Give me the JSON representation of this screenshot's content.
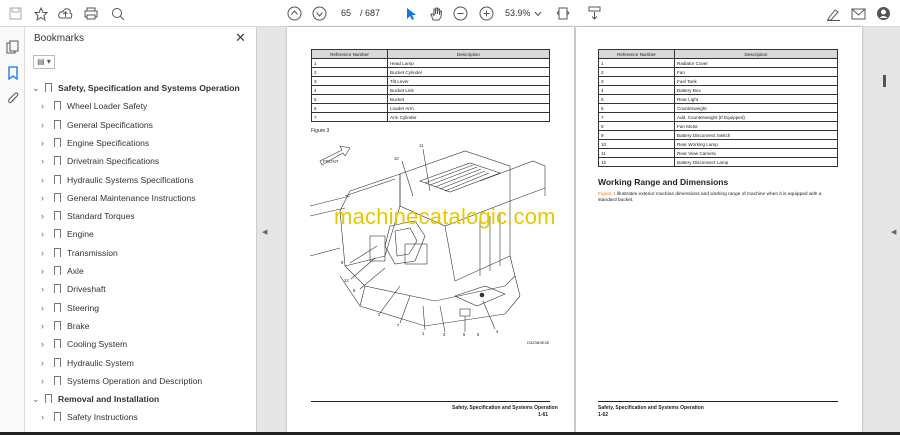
{
  "toolbar": {
    "page_current": "65",
    "page_total": "/ 687",
    "zoom": "53.9%"
  },
  "bookmarks_panel": {
    "title": "Bookmarks",
    "close": "✕",
    "items": [
      {
        "label": "Safety, Specification and Systems Operation",
        "level": 0,
        "expanded": true
      },
      {
        "label": "Wheel Loader Safety",
        "level": 1
      },
      {
        "label": "General Specifications",
        "level": 1
      },
      {
        "label": "Engine Specifications",
        "level": 1
      },
      {
        "label": "Drivetrain Specifications",
        "level": 1
      },
      {
        "label": "Hydraulic Systems Specifications",
        "level": 1
      },
      {
        "label": "General Maintenance Instructions",
        "level": 1
      },
      {
        "label": "Standard Torques",
        "level": 1
      },
      {
        "label": "Engine",
        "level": 1
      },
      {
        "label": "Transmission",
        "level": 1
      },
      {
        "label": "Axle",
        "level": 1
      },
      {
        "label": "Driveshaft",
        "level": 1
      },
      {
        "label": "Steering",
        "level": 1
      },
      {
        "label": "Brake",
        "level": 1
      },
      {
        "label": "Cooling System",
        "level": 1
      },
      {
        "label": "Hydraulic System",
        "level": 1
      },
      {
        "label": "Systems Operation and Description",
        "level": 1
      },
      {
        "label": "Removal and Installation",
        "level": 0,
        "expanded": true
      },
      {
        "label": "Safety Instructions",
        "level": 1
      }
    ]
  },
  "left_page": {
    "table_headers": [
      "Reference Number",
      "Description"
    ],
    "rows": [
      [
        "1",
        "Head Lamp"
      ],
      [
        "2",
        "Bucket Cylinder"
      ],
      [
        "3",
        "Tilt Lever"
      ],
      [
        "4",
        "Bucket Link"
      ],
      [
        "5",
        "Bucket"
      ],
      [
        "6",
        "Loader Arm"
      ],
      [
        "7",
        "Arm Cylinder"
      ]
    ],
    "figure_label": "Figure 3",
    "front_label": "FRONT",
    "callouts": [
      "10",
      "11",
      "9",
      "12",
      "8",
      "2",
      "7",
      "1",
      "3",
      "6",
      "5",
      "4"
    ],
    "drawing_code": "D3Z3B3E3E",
    "footer_title": "Safety, Specification and Systems Operation",
    "footer_page": "1-61"
  },
  "right_page": {
    "table_headers": [
      "Reference Number",
      "Description"
    ],
    "rows": [
      [
        "1",
        "Radiator Cover"
      ],
      [
        "2",
        "Fan"
      ],
      [
        "3",
        "Fuel Tank"
      ],
      [
        "4",
        "Battery Box"
      ],
      [
        "5",
        "Rear Light"
      ],
      [
        "6",
        "Counterweight"
      ],
      [
        "7",
        "Add. Counterweight (If Equipped)"
      ],
      [
        "8",
        "Fan Motor"
      ],
      [
        "9",
        "Battery Disconnect Switch"
      ],
      [
        "10",
        "Rear Working Lamp"
      ],
      [
        "11",
        "Rear View Camera"
      ],
      [
        "12",
        "Battery Disconnect Lamp"
      ]
    ],
    "section_title": "Working Range and Dimensions",
    "para_link": "Figure 1",
    "para_text": " illustrates exterior machine dimensions and working range of machine when it is equipped with a standard bucket.",
    "footer_title": "Safety, Specification and Systems Operation",
    "footer_page": "1-62"
  },
  "watermark": "machinecatalogic.com"
}
